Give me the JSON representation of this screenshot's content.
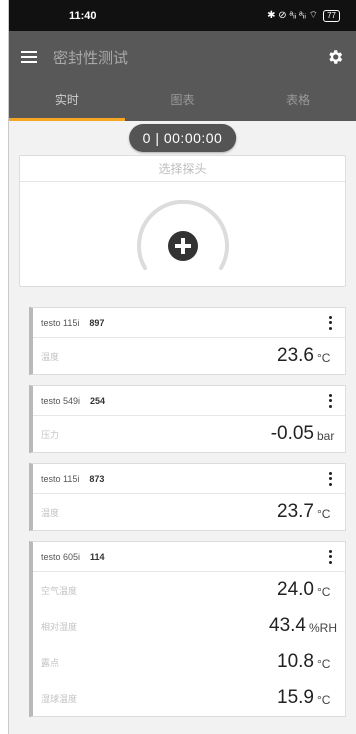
{
  "status_bar": {
    "time": "11:40",
    "icons_text": "✱ ⊘ ᵃᵢᵢ ᵃᵢᵢ ⌔",
    "battery": "77"
  },
  "app_bar": {
    "title": "密封性测试"
  },
  "tabs": [
    {
      "label": "实时",
      "active": true
    },
    {
      "label": "图表",
      "active": false
    },
    {
      "label": "表格",
      "active": false
    }
  ],
  "timer": "0 | 00:00:00",
  "probe_select": {
    "label": "选择探头"
  },
  "cards": [
    {
      "name": "testo 115i",
      "serial": "897",
      "rows": [
        {
          "label": "温度",
          "value": "23.6",
          "unit": "°C"
        }
      ]
    },
    {
      "name": "testo 549i",
      "serial": "254",
      "rows": [
        {
          "label": "压力",
          "value": "-0.05",
          "unit": "bar"
        }
      ]
    },
    {
      "name": "testo 115i",
      "serial": "873",
      "rows": [
        {
          "label": "温度",
          "value": "23.7",
          "unit": "°C"
        }
      ]
    },
    {
      "name": "testo 605i",
      "serial": "114",
      "rows": [
        {
          "label": "空气温度",
          "value": "24.0",
          "unit": "°C"
        },
        {
          "label": "相对湿度",
          "value": "43.4",
          "unit": "%RH"
        },
        {
          "label": "露点",
          "value": "10.8",
          "unit": "°C"
        },
        {
          "label": "湿球温度",
          "value": "15.9",
          "unit": "°C"
        }
      ]
    }
  ]
}
